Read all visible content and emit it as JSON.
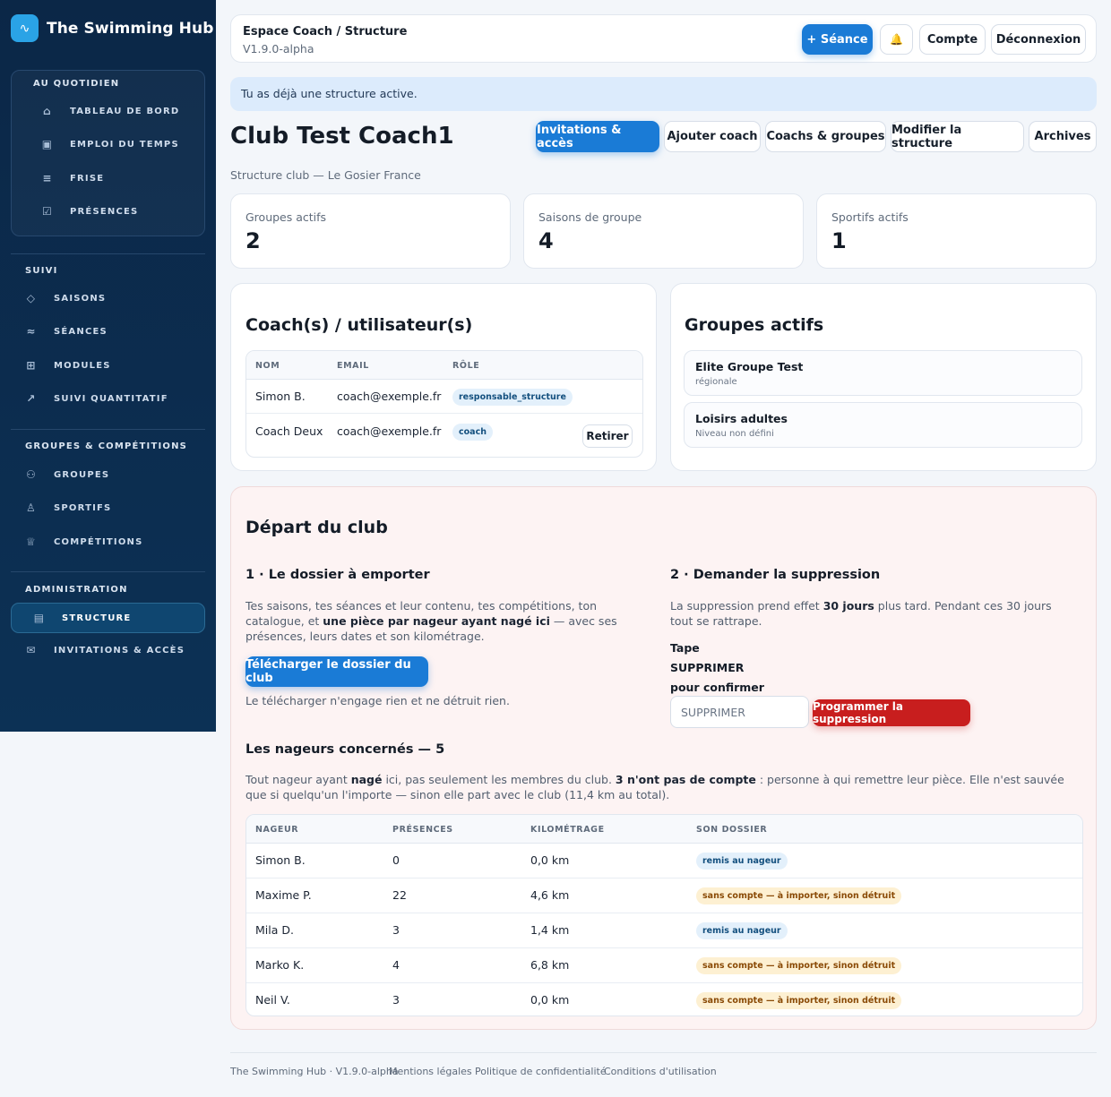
{
  "brand": {
    "name": "The Swimming Hub",
    "logo_icon": "wave-icon"
  },
  "sidebar": {
    "sections": [
      {
        "title": "AU QUOTIDIEN",
        "items": [
          {
            "label": "TABLEAU DE BORD",
            "icon": "home-icon"
          },
          {
            "label": "EMPLOI DU TEMPS",
            "icon": "calendar-icon"
          },
          {
            "label": "FRISE",
            "icon": "timeline-icon"
          },
          {
            "label": "PRÉSENCES",
            "icon": "checklist-icon"
          }
        ]
      },
      {
        "title": "SUIVI",
        "items": [
          {
            "label": "SAISONS",
            "icon": "layers-icon"
          },
          {
            "label": "SÉANCES",
            "icon": "waves-icon"
          },
          {
            "label": "MODULES",
            "icon": "grid-icon"
          },
          {
            "label": "SUIVI QUANTITATIF",
            "icon": "trend-icon"
          }
        ]
      },
      {
        "title": "GROUPES & COMPÉTITIONS",
        "items": [
          {
            "label": "GROUPES",
            "icon": "users-icon"
          },
          {
            "label": "SPORTIFS",
            "icon": "user-icon"
          },
          {
            "label": "COMPÉTITIONS",
            "icon": "trophy-icon"
          }
        ]
      },
      {
        "title": "ADMINISTRATION",
        "items": [
          {
            "label": "STRUCTURE",
            "icon": "document-icon",
            "active": true
          },
          {
            "label": "INVITATIONS & ACCÈS",
            "icon": "mail-icon"
          }
        ]
      }
    ]
  },
  "topbar": {
    "breadcrumb": "Espace Coach / Structure",
    "version": "V1.9.0-alpha",
    "new_session": "+ Séance",
    "bell_icon": "bell-icon",
    "account": "Compte",
    "logout": "Déconnexion"
  },
  "alert": "Tu as déjà une structure active.",
  "page": {
    "title": "Club Test Coach1",
    "subtitle": "Structure club — Le Gosier France",
    "tabs": [
      "Invitations & accès",
      "Ajouter coach",
      "Coachs & groupes",
      "Modifier la structure",
      "Archives"
    ]
  },
  "stats": [
    {
      "label": "Groupes actifs",
      "value": "2"
    },
    {
      "label": "Saisons de groupe",
      "value": "4"
    },
    {
      "label": "Sportifs actifs",
      "value": "1"
    }
  ],
  "coaches": {
    "title": "Coach(s) / utilisateur(s)",
    "headers": [
      "NOM",
      "EMAIL",
      "RÔLE"
    ],
    "rows": [
      {
        "name": "Simon B.",
        "email": "coach@exemple.fr",
        "role": "responsable_structure"
      },
      {
        "name": "Coach Deux",
        "email": "coach@exemple.fr",
        "role": "coach",
        "action": "Retirer"
      }
    ]
  },
  "groups": {
    "title": "Groupes actifs",
    "items": [
      {
        "name": "Elite Groupe Test",
        "level": "régionale"
      },
      {
        "name": "Loisirs adultes",
        "level": "Niveau non défini"
      }
    ]
  },
  "departure": {
    "title": "Départ du club",
    "step1": {
      "title": "1 · Le dossier à emporter",
      "text_a": "Tes saisons, tes séances et leur contenu, tes compétitions, ton catalogue, et ",
      "text_b": "une pièce par nageur ayant nagé ici",
      "text_c": " — avec ses présences, leurs dates et son kilométrage.",
      "button": "Télécharger le dossier du club",
      "note": "Le télécharger n'engage rien et ne détruit rien."
    },
    "step2": {
      "title": "2 · Demander la suppression",
      "text_a": "La suppression prend effet ",
      "text_b": "30 jours",
      "text_c": " plus tard. Pendant ces 30 jours tout se rattrape.",
      "confirm_1": "Tape",
      "confirm_2": "SUPPRIMER",
      "confirm_3": "pour confirmer",
      "input_placeholder": "SUPPRIMER",
      "button": "Programmer la suppression"
    },
    "swimmers": {
      "title": "Les nageurs concernés — 5",
      "text_a": "Tout nageur ayant ",
      "text_b": "nagé",
      "text_c": " ici, pas seulement les membres du club. ",
      "text_d": "3 n'ont pas de compte",
      "text_e": " : personne à qui remettre leur pièce. Elle n'est sauvée que si quelqu'un l'importe — sinon elle part avec le club (11,4 km au total).",
      "headers": [
        "NAGEUR",
        "PRÉSENCES",
        "KILOMÉTRAGE",
        "SON DOSSIER"
      ],
      "rows": [
        {
          "name": "Simon B.",
          "presences": "0",
          "km": "0,0 km",
          "status": "remis au nageur",
          "tone": "blue"
        },
        {
          "name": "Maxime P.",
          "presences": "22",
          "km": "4,6 km",
          "status": "sans compte — à importer, sinon détruit",
          "tone": "amber"
        },
        {
          "name": "Mila D.",
          "presences": "3",
          "km": "1,4 km",
          "status": "remis au nageur",
          "tone": "blue"
        },
        {
          "name": "Marko K.",
          "presences": "4",
          "km": "6,8 km",
          "status": "sans compte — à importer, sinon détruit",
          "tone": "amber"
        },
        {
          "name": "Neil V.",
          "presences": "3",
          "km": "0,0 km",
          "status": "sans compte — à importer, sinon détruit",
          "tone": "amber"
        }
      ]
    }
  },
  "footer": {
    "brand": "The Swimming Hub · V1.9.0-alpha",
    "links": [
      "Mentions légales",
      "Politique de confidentialité",
      "Conditions d'utilisation"
    ]
  },
  "colors": {
    "sidebar": "#0b2747",
    "primary": "#1a7bd6",
    "danger": "#c81e1e",
    "alert_bg": "#dcebfc"
  }
}
